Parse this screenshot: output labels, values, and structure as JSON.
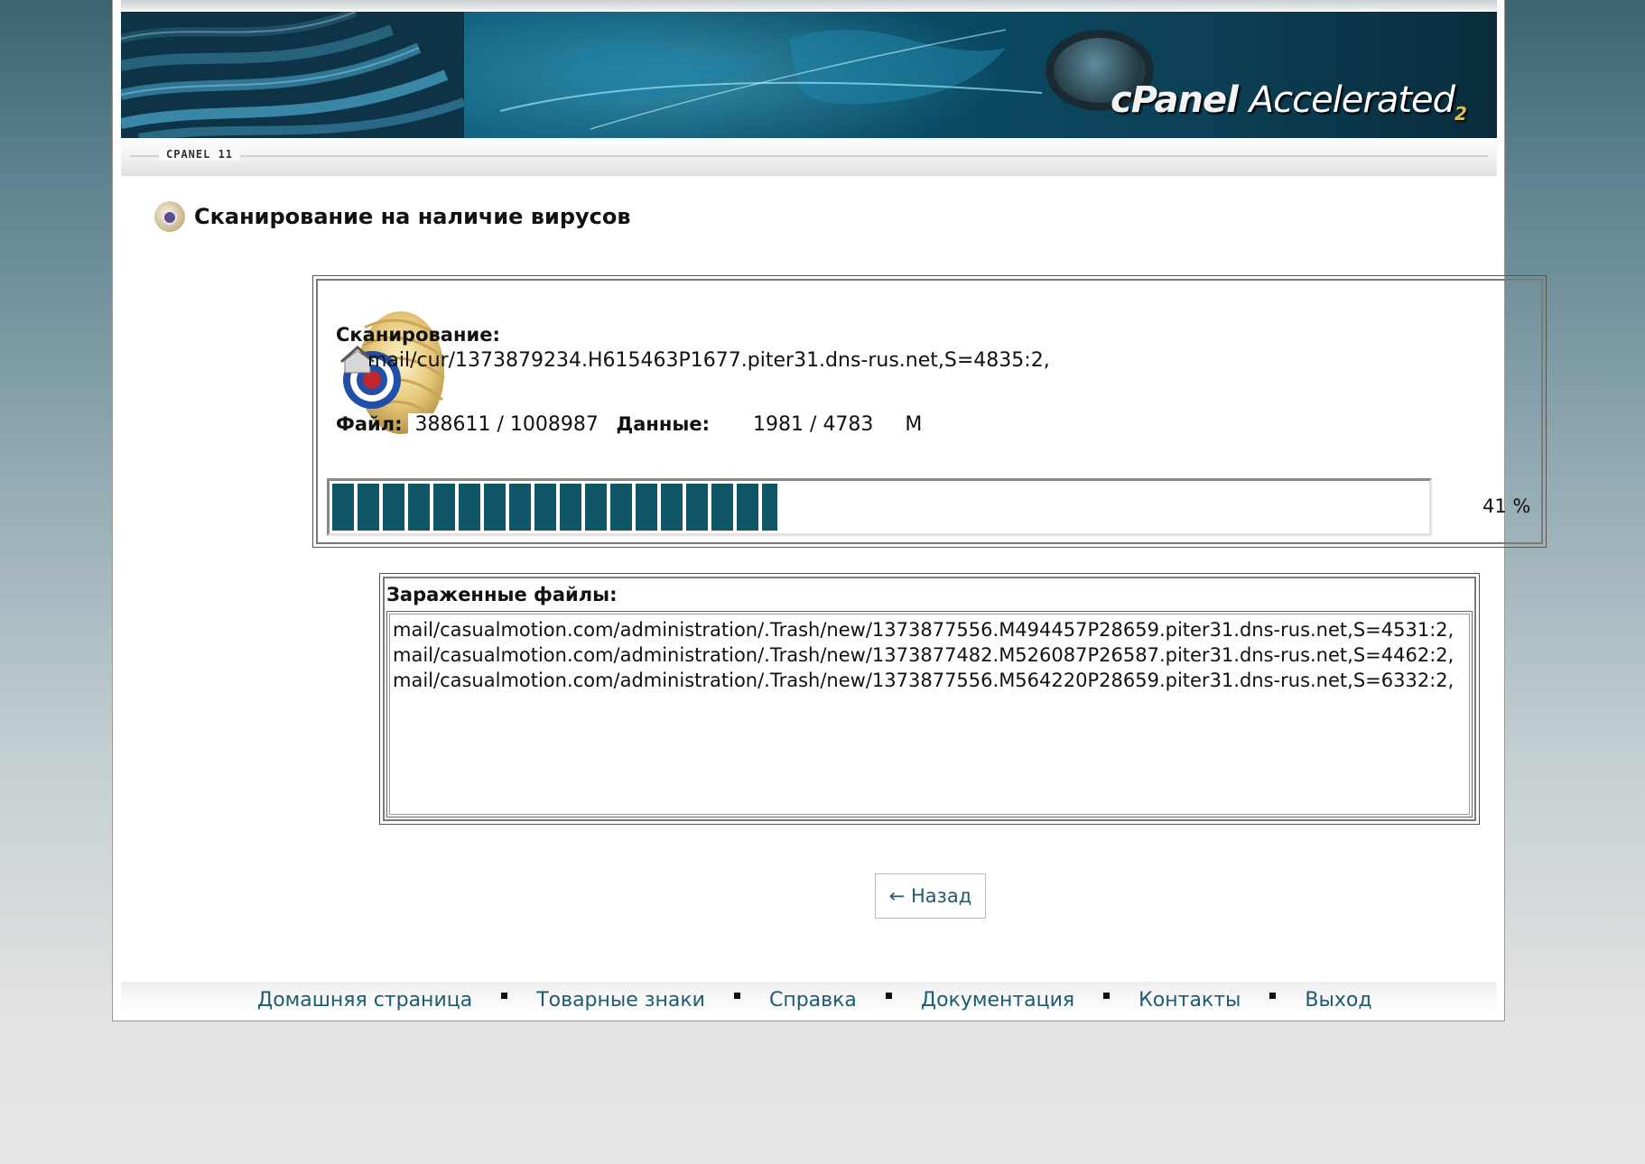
{
  "header": {
    "brand_prefix": "cPanel",
    "brand_suffix": "Accelerated",
    "brand_version": "2",
    "version_tag": "CPANEL 11"
  },
  "page": {
    "title": "Сканирование на наличие вирусов",
    "title_icon": "virus-scan-icon"
  },
  "scan": {
    "scanning_label": "Сканирование:",
    "current_path": "mail/cur/1373879234.H615463P1677.piter31.dns-rus.net,S=4835:2,",
    "file_label": "Файл:",
    "files_done": "388611",
    "files_total": "1008987",
    "data_label": "Данные:",
    "data_done": "1981",
    "data_total": "4783",
    "data_unit": "M",
    "progress_percent": 41,
    "progress_text": "41 %"
  },
  "infected": {
    "label": "Зараженные файлы:",
    "files": [
      "mail/casualmotion.com/administration/.Trash/new/1373877556.M494457P28659.piter31.dns-rus.net,S=4531:2,",
      "mail/casualmotion.com/administration/.Trash/new/1373877482.M526087P26587.piter31.dns-rus.net,S=4462:2,",
      "mail/casualmotion.com/administration/.Trash/new/1373877556.M564220P28659.piter31.dns-rus.net,S=6332:2,"
    ]
  },
  "actions": {
    "back_label": "← Назад"
  },
  "footer": {
    "links": [
      "Домашняя страница",
      "Товарные знаки",
      "Справка",
      "Документация",
      "Контакты",
      "Выход"
    ]
  },
  "colors": {
    "accent": "#1f5b70",
    "progress": "#0f5667"
  }
}
